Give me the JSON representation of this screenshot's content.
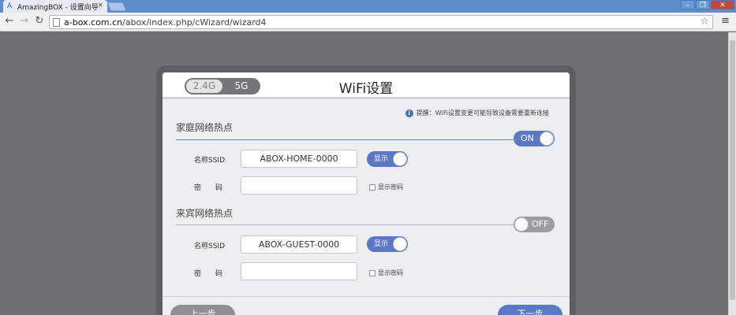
{
  "browser": {
    "tab_title": "AmazingBOX - 设置向导",
    "tab_close": "×",
    "url_host": "a-box.com.cn",
    "url_path": "/abox/index.php/cWizard/wizard4",
    "favicon": "A",
    "icons": {
      "back": "back-arrow-icon",
      "forward": "forward-arrow-icon",
      "reload": "reload-icon",
      "star": "star-icon",
      "menu": "hamburger-menu-icon"
    }
  },
  "wizard": {
    "band_options": [
      "2.4G",
      "5G"
    ],
    "title": "WiFi设置",
    "notice": "提醒：WiFi设置变更可能导致设备需要重新连接",
    "home": {
      "title": "家庭网络热点",
      "switch": "ON",
      "ssid_label": "名称SSID",
      "ssid_value": "ABOX-HOME-0000",
      "show_label": "显示",
      "password_label": "密　　码",
      "password_value": "",
      "show_password": "显示密码"
    },
    "guest": {
      "title": "来宾网络热点",
      "switch": "OFF",
      "ssid_label": "名称SSID",
      "ssid_value": "ABOX-GUEST-0000",
      "show_label": "显示",
      "password_label": "密　　码",
      "password_value": "",
      "show_password": "显示密码"
    },
    "prev_button": "上一步",
    "next_button": "下一步"
  },
  "colors": {
    "accent": "#5b78c4",
    "page_background": "#6f7074",
    "off_switch": "#9b9da2"
  }
}
